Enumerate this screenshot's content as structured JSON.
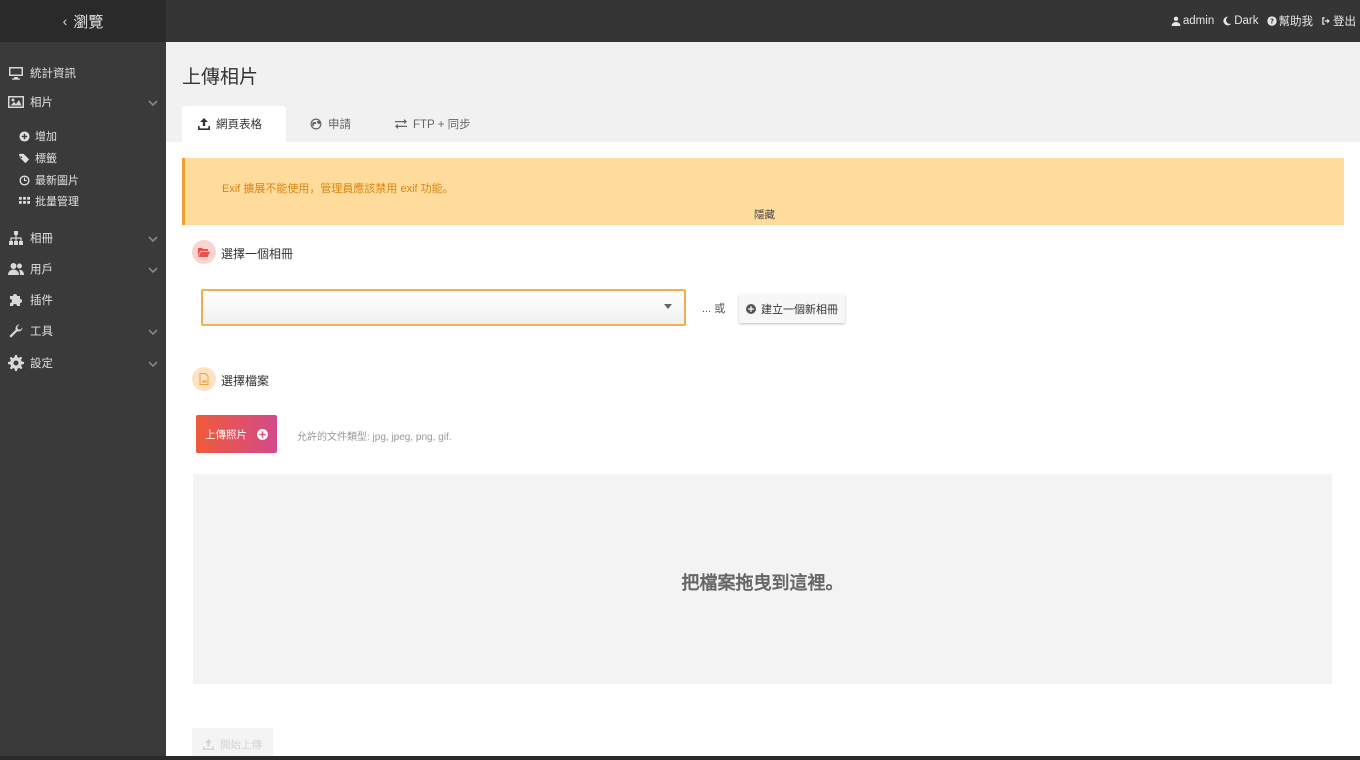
{
  "topbar": {
    "back_label": "瀏覽",
    "user": "admin",
    "theme": "Dark",
    "help": "幫助我",
    "logout": "登出"
  },
  "sidebar": {
    "items": [
      {
        "label": "統計資訊",
        "icon": "monitor-icon",
        "has_caret": false
      },
      {
        "label": "相片",
        "icon": "image-icon",
        "has_caret": true
      },
      {
        "label": "相冊",
        "icon": "sitemap-icon",
        "has_caret": true
      },
      {
        "label": "用戶",
        "icon": "users-icon",
        "has_caret": true
      },
      {
        "label": "插件",
        "icon": "puzzle-icon",
        "has_caret": false
      },
      {
        "label": "工具",
        "icon": "wrench-icon",
        "has_caret": true
      },
      {
        "label": "設定",
        "icon": "gear-icon",
        "has_caret": true
      }
    ],
    "photo_subitems": [
      {
        "label": "增加",
        "icon": "plus-circle-icon"
      },
      {
        "label": "標籤",
        "icon": "tags-icon"
      },
      {
        "label": "最新圖片",
        "icon": "clock-icon"
      },
      {
        "label": "批量管理",
        "icon": "grid-icon"
      }
    ]
  },
  "page": {
    "title": "上傳相片",
    "tabs": [
      {
        "label": "網頁表格",
        "icon": "upload-icon",
        "active": true
      },
      {
        "label": "申請",
        "icon": "globe-icon",
        "active": false
      },
      {
        "label": "FTP + 同步",
        "icon": "exchange-icon",
        "active": false
      }
    ]
  },
  "warning": {
    "message": "Exif 擴展不能使用，管理員應該禁用 exif 功能。",
    "hide_label": "隱藏"
  },
  "album_section": {
    "title": "選擇一個相冊",
    "select_value": "",
    "or_text": "... 或",
    "new_album_label": "建立一個新相冊"
  },
  "files_section": {
    "title": "選擇檔案",
    "upload_button_label": "上傳照片",
    "allowed_types": "允許的文件類型: jpg, jpeg, png, gif.",
    "dropzone_text": "把檔案拖曳到這裡。",
    "start_button_label": "開始上傳"
  },
  "colors": {
    "sidebar_bg": "#3a3a3a",
    "topbar_bg": "#353535",
    "warning_bg": "#ffdc9c",
    "warning_text": "#d9860f",
    "accent": "#f0a030",
    "upload_gradient_start": "#f05a3a",
    "upload_gradient_end": "#d34a8a"
  }
}
